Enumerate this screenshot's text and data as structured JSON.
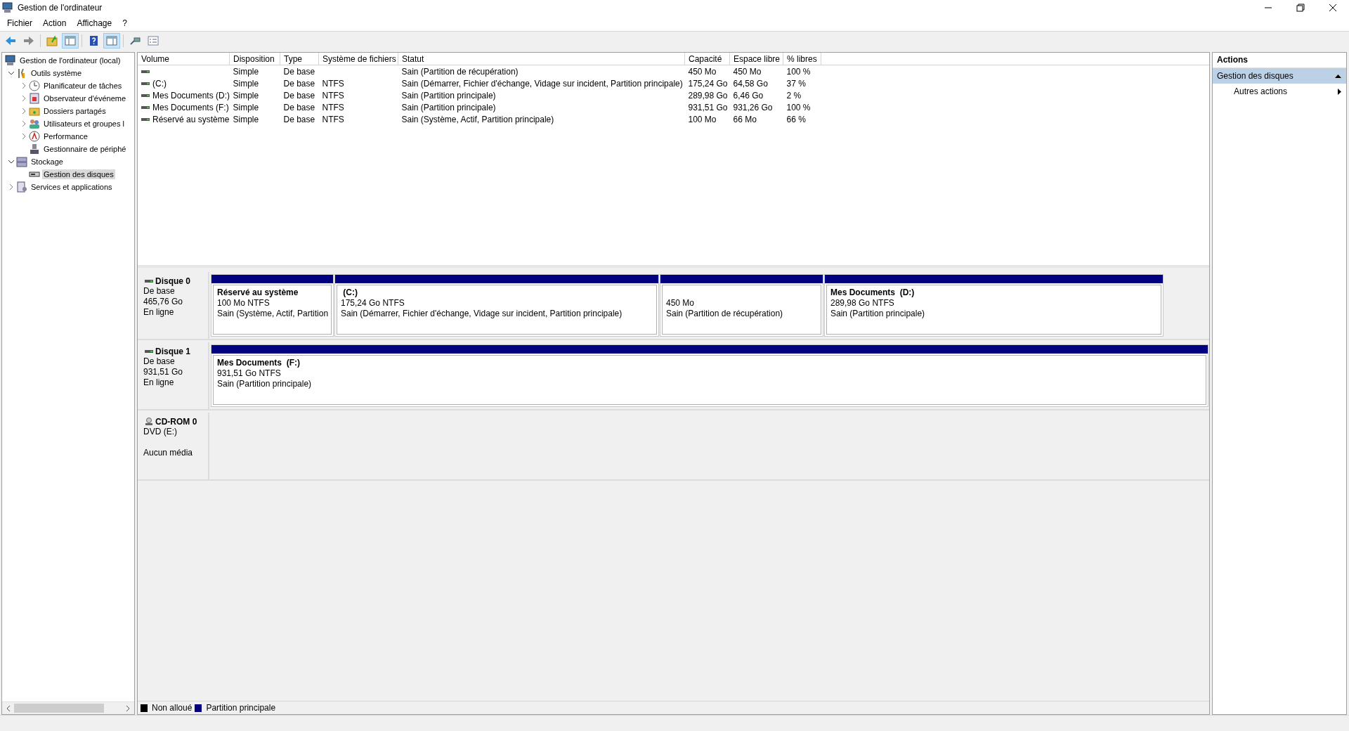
{
  "window": {
    "title": "Gestion de l'ordinateur"
  },
  "menu": [
    {
      "label": "Fichier"
    },
    {
      "label": "Action"
    },
    {
      "label": "Affichage"
    },
    {
      "label": "?"
    }
  ],
  "toolbar": [
    {
      "kind": "back",
      "on": false
    },
    {
      "kind": "forward",
      "on": false
    },
    {
      "kind": "up",
      "on": false
    },
    {
      "kind": "tree",
      "on": true
    },
    {
      "kind": "help",
      "on": false
    },
    {
      "kind": "pane",
      "on": true
    },
    {
      "kind": "connect",
      "on": false
    },
    {
      "kind": "properties",
      "on": false
    }
  ],
  "tree": [
    {
      "label": "Gestion de l'ordinateur (local)",
      "selected": false,
      "children": [
        {
          "label": "Outils système",
          "expanded": true,
          "selected": false,
          "children": [
            {
              "label": "Planificateur de tâches",
              "expanded": false,
              "selected": false
            },
            {
              "label": "Observateur d'événeme",
              "expanded": false,
              "selected": false
            },
            {
              "label": "Dossiers partagés",
              "expanded": false,
              "selected": false
            },
            {
              "label": "Utilisateurs et groupes l",
              "expanded": false,
              "selected": false
            },
            {
              "label": "Performance",
              "expanded": false,
              "selected": false
            },
            {
              "label": "Gestionnaire de périphé",
              "selected": false
            }
          ]
        },
        {
          "label": "Stockage",
          "expanded": true,
          "selected": false,
          "children": [
            {
              "label": "Gestion des disques",
              "selected": true
            }
          ]
        },
        {
          "label": "Services et applications",
          "expanded": false,
          "selected": false
        }
      ]
    }
  ],
  "table": {
    "columns": [
      "Volume",
      "Disposition",
      "Type",
      "Système de fichiers",
      "Statut",
      "Capacité",
      "Espace libre",
      "% libres"
    ],
    "rows": [
      {
        "cells": [
          "",
          "Simple",
          "De base",
          "",
          "Sain (Partition de récupération)",
          "450 Mo",
          "450 Mo",
          "100 %"
        ]
      },
      {
        "cells": [
          " (C:)",
          "Simple",
          "De base",
          "NTFS",
          "Sain (Démarrer, Fichier d'échange, Vidage sur incident, Partition principale)",
          "175,24 Go",
          "64,58 Go",
          "37 %"
        ]
      },
      {
        "cells": [
          "Mes Documents (D:)",
          "Simple",
          "De base",
          "NTFS",
          "Sain (Partition principale)",
          "289,98 Go",
          "6,46 Go",
          "2 %"
        ]
      },
      {
        "cells": [
          "Mes Documents (F:)",
          "Simple",
          "De base",
          "NTFS",
          "Sain (Partition principale)",
          "931,51 Go",
          "931,26 Go",
          "100 %"
        ]
      },
      {
        "cells": [
          "Réservé au système",
          "Simple",
          "De base",
          "NTFS",
          "Sain (Système, Actif, Partition principale)",
          "100 Mo",
          "66 Mo",
          "66 %"
        ]
      }
    ]
  },
  "disks": [
    {
      "kind": "disk",
      "name": "Disque 0",
      "info": [
        "De base",
        "465,76 Go",
        "En ligne"
      ],
      "partitions": [
        {
          "title": "Réservé au système",
          "size": "100 Mo NTFS",
          "status": "Sain (Système, Actif, Partition",
          "color": "#000080"
        },
        {
          "title": " (C:)",
          "size": "175,24 Go NTFS",
          "status": "Sain (Démarrer, Fichier d'échange, Vidage sur incident, Partition principale)",
          "color": "#000080"
        },
        {
          "size": "450 Mo",
          "status": "Sain (Partition de récupération)",
          "color": "#000080"
        },
        {
          "title": "Mes Documents  (D:)",
          "size": "289,98 Go NTFS",
          "status": "Sain (Partition principale)",
          "color": "#000080"
        }
      ]
    },
    {
      "kind": "disk",
      "name": "Disque 1",
      "info": [
        "De base",
        "931,51 Go",
        "En ligne"
      ],
      "partitions": [
        {
          "title": "Mes Documents  (F:)",
          "size": "931,51 Go NTFS",
          "status": "Sain (Partition principale)",
          "color": "#000080"
        }
      ]
    },
    {
      "kind": "cdrom",
      "name": "CD-ROM 0",
      "info": [
        "DVD (E:)"
      ],
      "media": "Aucun média"
    }
  ],
  "legend": [
    {
      "label": "Non alloué",
      "color": "#000000"
    },
    {
      "label": "Partition principale",
      "color": "#000080"
    }
  ],
  "actions": {
    "title": "Actions",
    "sections": [
      {
        "label": "Gestion des disques",
        "expanded": true,
        "items": [
          {
            "label": "Autres actions"
          }
        ]
      }
    ]
  }
}
